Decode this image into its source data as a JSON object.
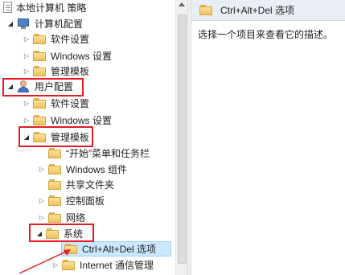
{
  "tree": {
    "root_label": "本地计算机 策略",
    "computer_config_label": "计算机配置",
    "computer_children": [
      "软件设置",
      "Windows 设置",
      "管理模板"
    ],
    "user_config_label": "用户配置",
    "user_children": [
      "软件设置",
      "Windows 设置"
    ],
    "admin_templates_label": "管理模板",
    "admin_children": [
      "“开始”菜单和任务栏",
      "Windows 组件",
      "共享文件夹",
      "控制面板",
      "网络"
    ],
    "system_label": "系统",
    "system_children": [
      "Ctrl+Alt+Del 选项",
      "Internet 通信管理"
    ]
  },
  "detail": {
    "header_title": "Ctrl+Alt+Del 选项",
    "description": "选择一个项目来查看它的描述。"
  },
  "colors": {
    "highlight_box": "#e31b23",
    "selection": "#cce8ff",
    "header_bg": "#e9eef5"
  }
}
